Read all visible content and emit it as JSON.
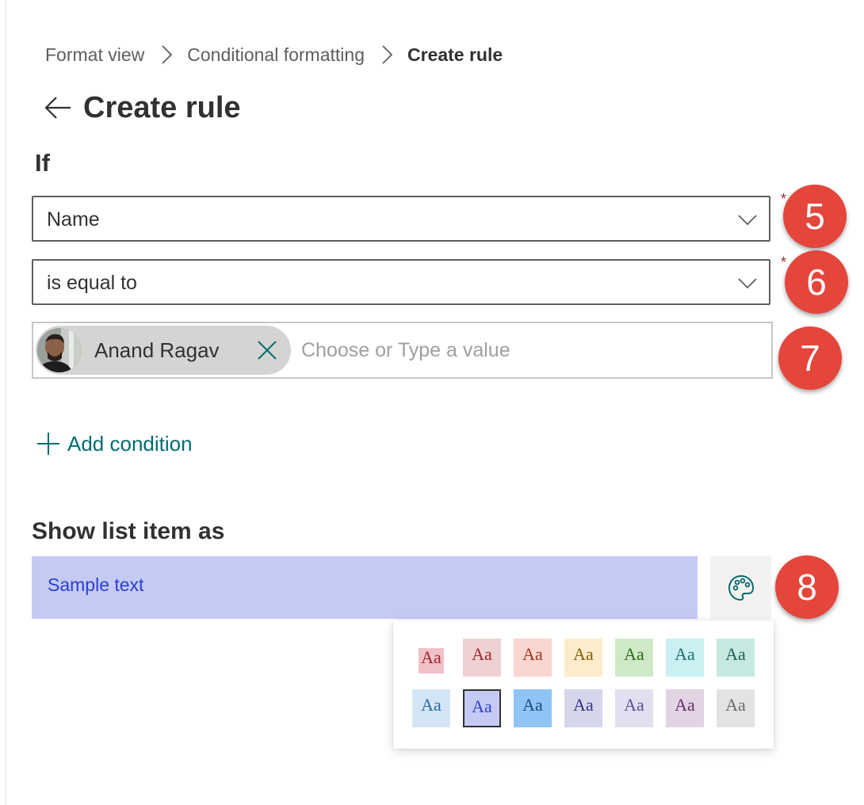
{
  "breadcrumb": {
    "items": [
      "Format view",
      "Conditional formatting",
      "Create rule"
    ]
  },
  "header": {
    "title": "Create rule"
  },
  "rule": {
    "if_label": "If",
    "field_dropdown": {
      "value": "Name",
      "required_mark": "*"
    },
    "operator_dropdown": {
      "value": "is equal to",
      "required_mark": "*"
    },
    "value_picker": {
      "selected_person": "Anand Ragav",
      "placeholder": "Choose or Type a value"
    },
    "add_condition_label": "Add condition"
  },
  "display": {
    "section_label": "Show list item as",
    "sample_text": "Sample text",
    "preview_bg": "#c5caf5",
    "preview_fg": "#2a3fd1",
    "palette_icon": "palette-icon"
  },
  "swatches": {
    "sample": "Aa",
    "rows": [
      [
        {
          "bg": "#f1c1c8",
          "fg": "#a4262c"
        },
        {
          "bg": "#eed1d2",
          "fg": "#a4262c"
        },
        {
          "bg": "#f9d6d0",
          "fg": "#a1361c"
        },
        {
          "bg": "#fdeccb",
          "fg": "#8a5a00"
        },
        {
          "bg": "#cfe9c8",
          "fg": "#2e6b19"
        },
        {
          "bg": "#c9f1f1",
          "fg": "#1e6f6f"
        },
        {
          "bg": "#c6e9e2",
          "fg": "#1e6056"
        }
      ],
      [
        {
          "bg": "#d4e6f5",
          "fg": "#2869a8"
        },
        {
          "bg": "#c5caf5",
          "fg": "#2a3fd1",
          "selected": true
        },
        {
          "bg": "#90c4f5",
          "fg": "#1a4c8b"
        },
        {
          "bg": "#d5d6ec",
          "fg": "#34358a"
        },
        {
          "bg": "#e2dff0",
          "fg": "#5e4e9a"
        },
        {
          "bg": "#e2d3e5",
          "fg": "#6b2f6f"
        },
        {
          "bg": "#e3e3e3",
          "fg": "#6b6b6b"
        }
      ]
    ]
  },
  "callouts": [
    "5",
    "6",
    "7",
    "8"
  ]
}
